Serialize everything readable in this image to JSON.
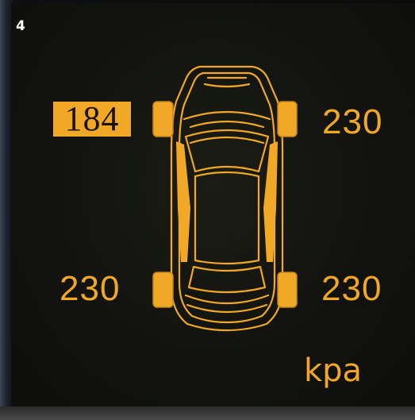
{
  "display": {
    "page_number": "4",
    "unit": "kpa",
    "accent_color": "#f2a827",
    "alert_tire": "front-left"
  },
  "tires": {
    "front_left": {
      "pressure": "184",
      "highlighted": true
    },
    "front_right": {
      "pressure": "230",
      "highlighted": false
    },
    "rear_left": {
      "pressure": "230",
      "highlighted": false
    },
    "rear_right": {
      "pressure": "230",
      "highlighted": false
    }
  }
}
